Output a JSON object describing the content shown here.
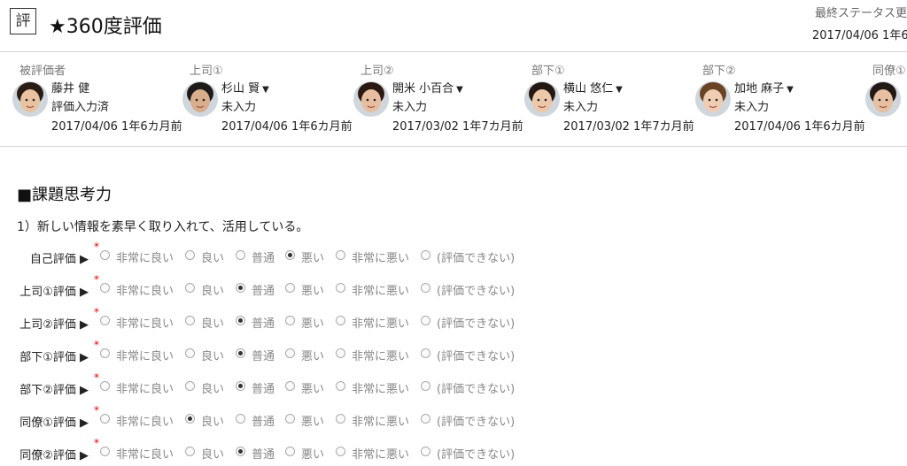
{
  "header": {
    "logo_char": "評",
    "title": "★360度評価",
    "status_label": "最終ステータス更",
    "status_date": "2017/04/06 1年6"
  },
  "people": [
    {
      "role": "被評価者",
      "name": "藤井 健",
      "status": "評価入力済",
      "date": "2017/04/06 1年6カ月前",
      "dropdown": false,
      "avatar_skin": "#e9c2a0",
      "avatar_hair": "#2a1c14"
    },
    {
      "role": "上司①",
      "name": "杉山 賢",
      "status": "未入力",
      "date": "2017/04/06 1年6カ月前",
      "dropdown": true,
      "avatar_skin": "#d9ae8c",
      "avatar_hair": "#1e1a18"
    },
    {
      "role": "上司②",
      "name": "開米 小百合",
      "status": "未入力",
      "date": "2017/03/02 1年7カ月前",
      "dropdown": true,
      "avatar_skin": "#e7bfa0",
      "avatar_hair": "#2b1a12"
    },
    {
      "role": "部下①",
      "name": "横山 悠仁",
      "status": "未入力",
      "date": "2017/03/02 1年7カ月前",
      "dropdown": true,
      "avatar_skin": "#ecc7a8",
      "avatar_hair": "#241812"
    },
    {
      "role": "部下②",
      "name": "加地 麻子",
      "status": "未入力",
      "date": "2017/04/06 1年6カ月前",
      "dropdown": true,
      "avatar_skin": "#f0cdb2",
      "avatar_hair": "#6b4426"
    },
    {
      "role": "同僚①",
      "name": "",
      "status": "",
      "date": "",
      "dropdown": false,
      "avatar_skin": "#e6c0a0",
      "avatar_hair": "#221814"
    }
  ],
  "section_title": "■課題思考力",
  "question": "1）新しい情報を素早く取り入れて、活用している。",
  "options": [
    "非常に良い",
    "良い",
    "普通",
    "悪い",
    "非常に悪い",
    "(評価できない)"
  ],
  "required_mark": "*",
  "ratings": [
    {
      "label": "自己評価 ▶",
      "selected": 3
    },
    {
      "label": "上司①評価 ▶",
      "selected": 2
    },
    {
      "label": "上司②評価 ▶",
      "selected": 2
    },
    {
      "label": "部下①評価 ▶",
      "selected": 2
    },
    {
      "label": "部下②評価 ▶",
      "selected": 2
    },
    {
      "label": "同僚①評価 ▶",
      "selected": 1
    },
    {
      "label": "同僚②評価 ▶",
      "selected": 2
    }
  ]
}
